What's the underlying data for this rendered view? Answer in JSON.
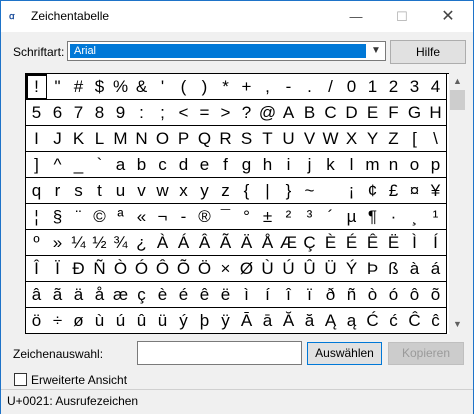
{
  "window": {
    "title": "Zeichentabelle",
    "icon_label": "ꭤ",
    "minimize_icon": "—",
    "maximize_icon": "☐",
    "close_icon": "✕"
  },
  "font": {
    "label": "Schriftart:",
    "selected": "Arial",
    "help_label": "Hilfe"
  },
  "grid": {
    "rows": [
      [
        "!",
        "\"",
        "#",
        "$",
        "%",
        "&",
        "'",
        "(",
        ")",
        "*",
        "+",
        ",",
        "-",
        ".",
        "/",
        "0",
        "1",
        "2",
        "3",
        "4"
      ],
      [
        "5",
        "6",
        "7",
        "8",
        "9",
        ":",
        ";",
        "<",
        "=",
        ">",
        "?",
        "@",
        "A",
        "B",
        "C",
        "D",
        "E",
        "F",
        "G",
        "H"
      ],
      [
        "I",
        "J",
        "K",
        "L",
        "M",
        "N",
        "O",
        "P",
        "Q",
        "R",
        "S",
        "T",
        "U",
        "V",
        "W",
        "X",
        "Y",
        "Z",
        "[",
        "\\"
      ],
      [
        "]",
        "^",
        "_",
        "`",
        "a",
        "b",
        "c",
        "d",
        "e",
        "f",
        "g",
        "h",
        "i",
        "j",
        "k",
        "l",
        "m",
        "n",
        "o",
        "p"
      ],
      [
        "q",
        "r",
        "s",
        "t",
        "u",
        "v",
        "w",
        "x",
        "y",
        "z",
        "{",
        "|",
        "}",
        "~",
        " ",
        "¡",
        "¢",
        "£",
        "¤",
        "¥"
      ],
      [
        "¦",
        "§",
        "¨",
        "©",
        "ª",
        "«",
        "¬",
        "-",
        "®",
        "¯",
        "°",
        "±",
        "²",
        "³",
        "´",
        "µ",
        "¶",
        "·",
        "¸",
        "¹"
      ],
      [
        "º",
        "»",
        "¼",
        "½",
        "¾",
        "¿",
        "À",
        "Á",
        "Â",
        "Ã",
        "Ä",
        "Å",
        "Æ",
        "Ç",
        "È",
        "É",
        "Ê",
        "Ë",
        "Ì",
        "Í"
      ],
      [
        "Î",
        "Ï",
        "Ð",
        "Ñ",
        "Ò",
        "Ó",
        "Ô",
        "Õ",
        "Ö",
        "×",
        "Ø",
        "Ù",
        "Ú",
        "Û",
        "Ü",
        "Ý",
        "Þ",
        "ß",
        "à",
        "á"
      ],
      [
        "â",
        "ã",
        "ä",
        "å",
        "æ",
        "ç",
        "è",
        "é",
        "ê",
        "ë",
        "ì",
        "í",
        "î",
        "ï",
        "ð",
        "ñ",
        "ò",
        "ó",
        "ô",
        "õ"
      ],
      [
        "ö",
        "÷",
        "ø",
        "ù",
        "ú",
        "û",
        "ü",
        "ý",
        "þ",
        "ÿ",
        "Ā",
        "ā",
        "Ă",
        "ă",
        "Ą",
        "ą",
        "Ć",
        "ć",
        "Ĉ",
        "ĉ"
      ]
    ]
  },
  "bottom": {
    "copy_label": "Zeichenauswahl:",
    "copy_value": "",
    "select_label": "Auswählen",
    "copy_button_label": "Kopieren",
    "advanced_label": "Erweiterte Ansicht",
    "advanced_checked": false
  },
  "status": {
    "text": "U+0021: Ausrufezeichen"
  }
}
